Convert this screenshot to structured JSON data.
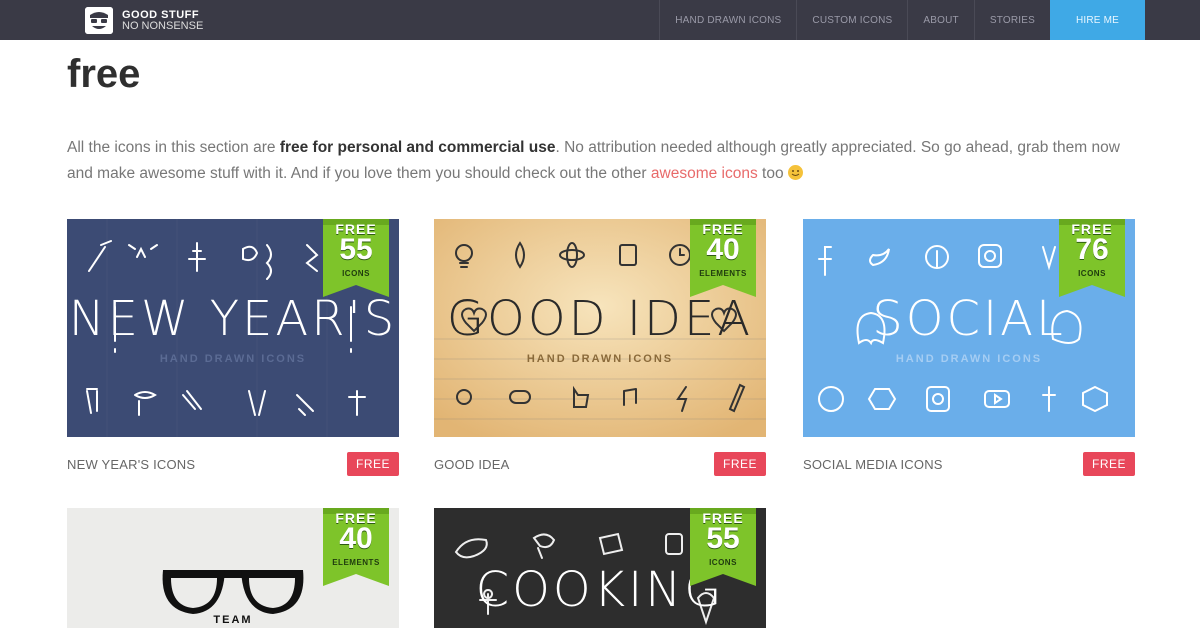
{
  "brand": {
    "title": "GOOD STUFF",
    "subtitle": "NO NONSENSE"
  },
  "nav": {
    "items": [
      "HAND DRAWN ICONS",
      "CUSTOM ICONS",
      "ABOUT",
      "STORIES"
    ],
    "hire": "HIRE ME"
  },
  "page": {
    "title": "free",
    "intro_pre": "All the icons in this section are ",
    "intro_bold": "free for personal and commercial use",
    "intro_mid": ". No attribution needed although greatly appreciated. So go ahead, grab them now and make awesome stuff with it. And if you love them you should check out the other ",
    "intro_link": "awesome icons",
    "intro_post": " too "
  },
  "cards": [
    {
      "caption": "NEW YEAR'S ICONS",
      "badge": "FREE",
      "ribbon_free": "FREE",
      "ribbon_count": "55",
      "ribbon_unit": "ICONS",
      "headline": "NEW YEAR'S",
      "subline": "HAND DRAWN ICONS",
      "bg": "#3c4b74"
    },
    {
      "caption": "GOOD IDEA",
      "badge": "FREE",
      "ribbon_free": "FREE",
      "ribbon_count": "40",
      "ribbon_unit": "ELEMENTS",
      "headline": "GOOD IDEA",
      "subline": "HAND DRAWN ICONS",
      "bg": "#f1d19b"
    },
    {
      "caption": "SOCIAL MEDIA ICONS",
      "badge": "FREE",
      "ribbon_free": "FREE",
      "ribbon_count": "76",
      "ribbon_unit": "ICONS",
      "headline": "SOCIAL",
      "subline": "HAND DRAWN ICONS",
      "bg": "#6aaeea"
    },
    {
      "caption": "",
      "badge": "",
      "ribbon_free": "FREE",
      "ribbon_count": "40",
      "ribbon_unit": "ELEMENTS",
      "headline": "",
      "subline": "TEAM",
      "bg": "#ececea"
    },
    {
      "caption": "",
      "badge": "",
      "ribbon_free": "FREE",
      "ribbon_count": "55",
      "ribbon_unit": "ICONS",
      "headline": "COOKING",
      "subline": "",
      "bg": "#2d2d2d"
    }
  ],
  "colors": {
    "topbar": "#3a3a46",
    "hire": "#3fa9e6",
    "badge": "#e8475a",
    "ribbon": "#7ec42a",
    "link": "#e86a6a"
  }
}
